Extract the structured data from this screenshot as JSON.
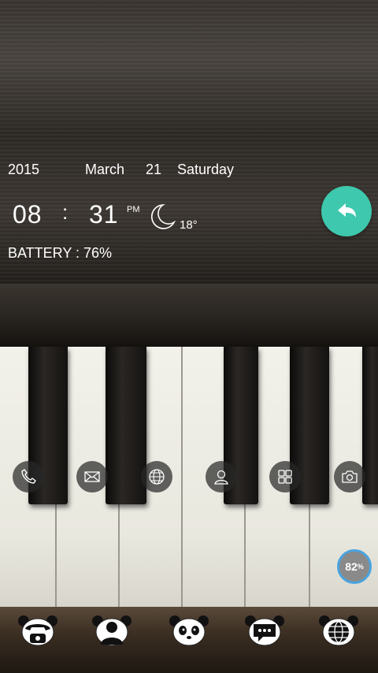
{
  "widget": {
    "year": "2015",
    "month": "March",
    "day": "21",
    "weekday": "Saturday",
    "hour": "08",
    "separator": ":",
    "minute": "31",
    "ampm": "PM",
    "weather_icon": "crescent-moon-icon",
    "temperature": "18°",
    "battery": "BATTERY : 76%"
  },
  "back_button": {
    "icon": "back-arrow-icon",
    "color": "#3ec8ad"
  },
  "dock": [
    {
      "name": "phone-icon"
    },
    {
      "name": "mail-icon"
    },
    {
      "name": "globe-icon"
    },
    {
      "name": "contact-icon"
    },
    {
      "name": "apps-grid-icon"
    },
    {
      "name": "camera-icon"
    }
  ],
  "ram_widget": {
    "value": "82",
    "unit": "%"
  },
  "bottom_bar": [
    {
      "name": "panda-phone-icon"
    },
    {
      "name": "panda-contacts-icon"
    },
    {
      "name": "panda-home-icon"
    },
    {
      "name": "panda-messages-icon"
    },
    {
      "name": "panda-browser-icon"
    }
  ]
}
